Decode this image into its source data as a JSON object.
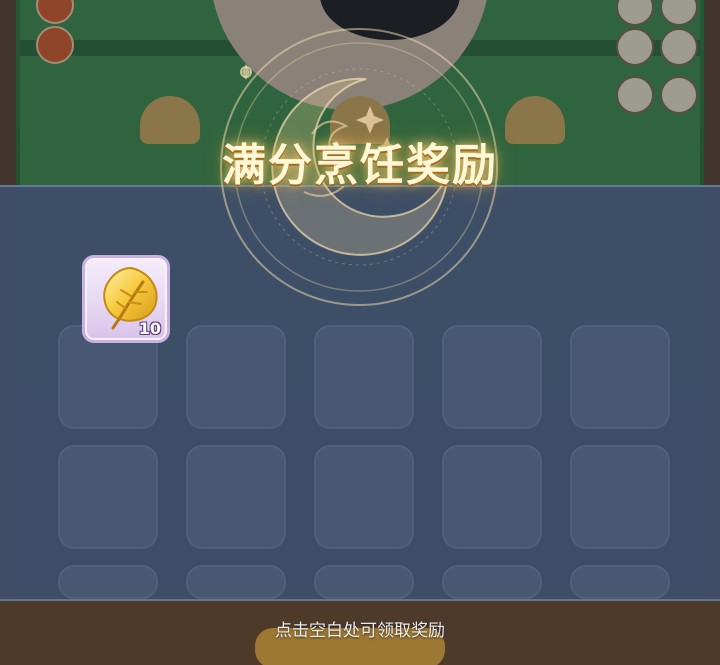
{
  "popup": {
    "title": "满分烹饪奖励",
    "dismiss_hint": "点击空白处可领取奖励"
  },
  "rewards": [
    {
      "icon": "golden-leaf-icon",
      "quantity": "10",
      "rarity_color": "#cbb0e4"
    }
  ],
  "colors": {
    "title_glow": "#e6aa3c",
    "band": "#3f506c",
    "item_frame": "#cbb0e4"
  }
}
